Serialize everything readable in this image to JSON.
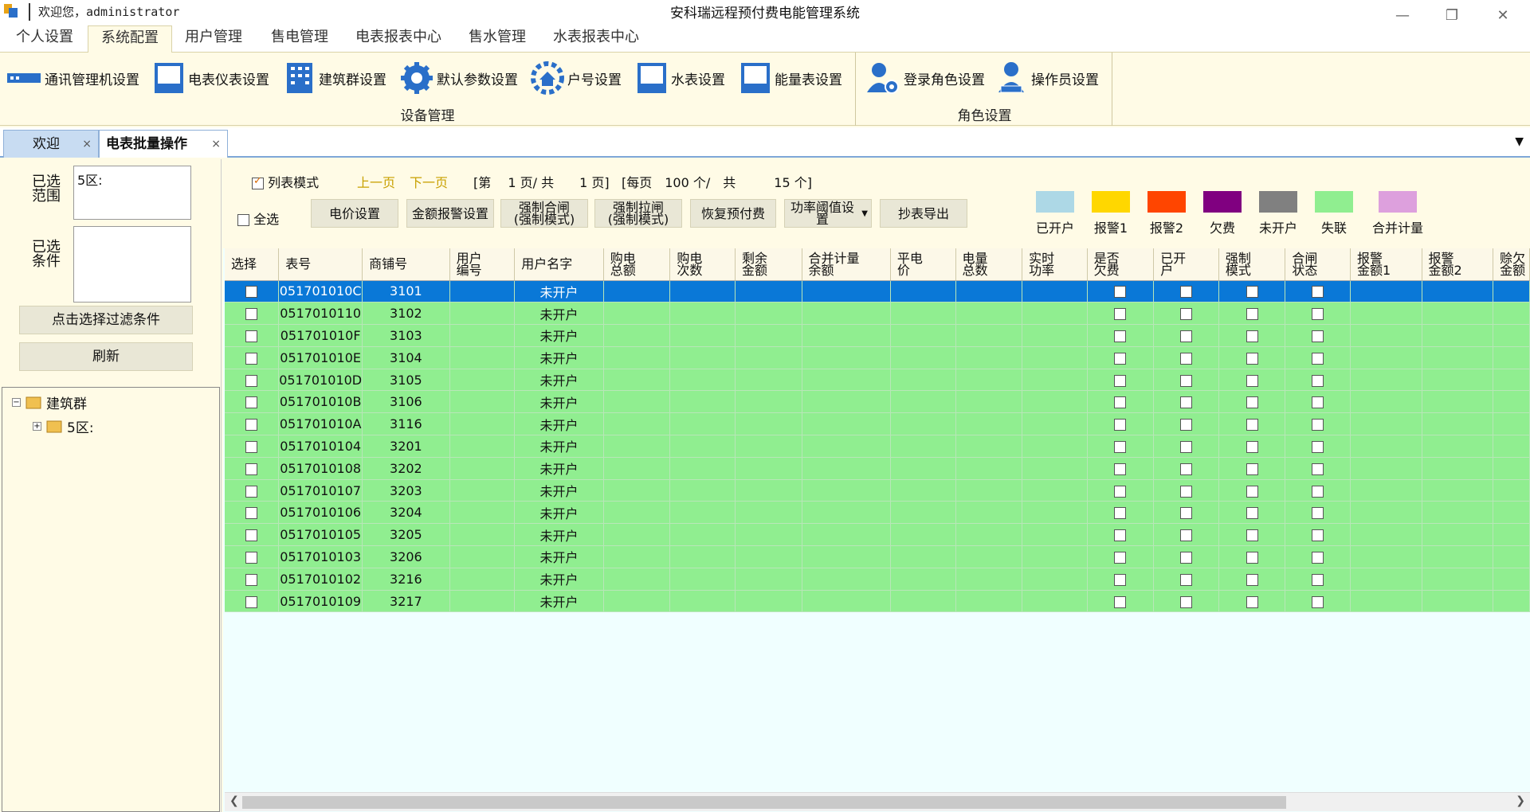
{
  "titlebar": {
    "welcome": "欢迎您，administrator",
    "title": "安科瑞远程预付费电能管理系统",
    "minimize": "—",
    "restore": "❐",
    "close": "✕"
  },
  "menu": {
    "tabs": [
      "个人设置",
      "系统配置",
      "用户管理",
      "售电管理",
      "电表报表中心",
      "售水管理",
      "水表报表中心"
    ],
    "active": "系统配置"
  },
  "ribbon": {
    "device_group": {
      "label": "设备管理",
      "buttons": [
        "通讯管理机设置",
        "电表仪表设置",
        "建筑群设置",
        "默认参数设置",
        "户号设置",
        "水表设置",
        "能量表设置"
      ]
    },
    "role_group": {
      "label": "角色设置",
      "buttons": [
        "登录角色设置",
        "操作员设置"
      ]
    }
  },
  "doc_tabs": [
    {
      "label": "欢迎",
      "close": "×"
    },
    {
      "label": "电表批量操作",
      "close": "×"
    }
  ],
  "left": {
    "scope_label": "已选范围",
    "scope_value": "5区:",
    "cond_label": "已选条件",
    "cond_value": "",
    "filter_button": "点击选择过滤条件",
    "refresh_button": "刷新",
    "tree": {
      "root": "建筑群",
      "child": "5区:"
    }
  },
  "toolbar": {
    "list_mode": "列表模式",
    "prev_page": "上一页",
    "next_page": "下一页",
    "page_info": "[第　 1 页/ 共　　1 页]",
    "per_page_info": "[每页　100 个/　共　　　15 个]",
    "select_all": "全选",
    "buttons": [
      "电价设置",
      "金额报警设置",
      "强制合闸\n(强制模式)",
      "强制拉闸\n(强制模式)",
      "恢复预付费",
      "功率阈值设置",
      "抄表导出"
    ]
  },
  "legend": [
    {
      "label": "已开户",
      "color": "#add8e6"
    },
    {
      "label": "报警1",
      "color": "#ffd700"
    },
    {
      "label": "报警2",
      "color": "#ff4500"
    },
    {
      "label": "欠费",
      "color": "#800080"
    },
    {
      "label": "未开户",
      "color": "#808080"
    },
    {
      "label": "失联",
      "color": "#90ee90"
    },
    {
      "label": "合并计量",
      "color": "#dda0dd"
    }
  ],
  "grid": {
    "columns": [
      "选择",
      "表号",
      "商铺号",
      "用户\n编号",
      "用户名字",
      "购电\n总额",
      "购电\n次数",
      "剩余\n金额",
      "合并计量\n余额",
      "平电\n价",
      "电量\n总数",
      "实时\n功率",
      "是否\n欠费",
      "已开\n户",
      "强制\n模式",
      "合闸\n状态",
      "报警\n金额1",
      "报警\n金额2",
      "赊欠\n金额"
    ],
    "rows": [
      {
        "meter": "051701010C",
        "shop": "3101",
        "name": "未开户"
      },
      {
        "meter": "0517010110",
        "shop": "3102",
        "name": "未开户"
      },
      {
        "meter": "051701010F",
        "shop": "3103",
        "name": "未开户"
      },
      {
        "meter": "051701010E",
        "shop": "3104",
        "name": "未开户"
      },
      {
        "meter": "051701010D",
        "shop": "3105",
        "name": "未开户"
      },
      {
        "meter": "051701010B",
        "shop": "3106",
        "name": "未开户"
      },
      {
        "meter": "051701010A",
        "shop": "3116",
        "name": "未开户"
      },
      {
        "meter": "0517010104",
        "shop": "3201",
        "name": "未开户"
      },
      {
        "meter": "0517010108",
        "shop": "3202",
        "name": "未开户"
      },
      {
        "meter": "0517010107",
        "shop": "3203",
        "name": "未开户"
      },
      {
        "meter": "0517010106",
        "shop": "3204",
        "name": "未开户"
      },
      {
        "meter": "0517010105",
        "shop": "3205",
        "name": "未开户"
      },
      {
        "meter": "0517010103",
        "shop": "3206",
        "name": "未开户"
      },
      {
        "meter": "0517010102",
        "shop": "3216",
        "name": "未开户"
      },
      {
        "meter": "0517010109",
        "shop": "3217",
        "name": "未开户"
      }
    ],
    "selected_row": 0
  }
}
